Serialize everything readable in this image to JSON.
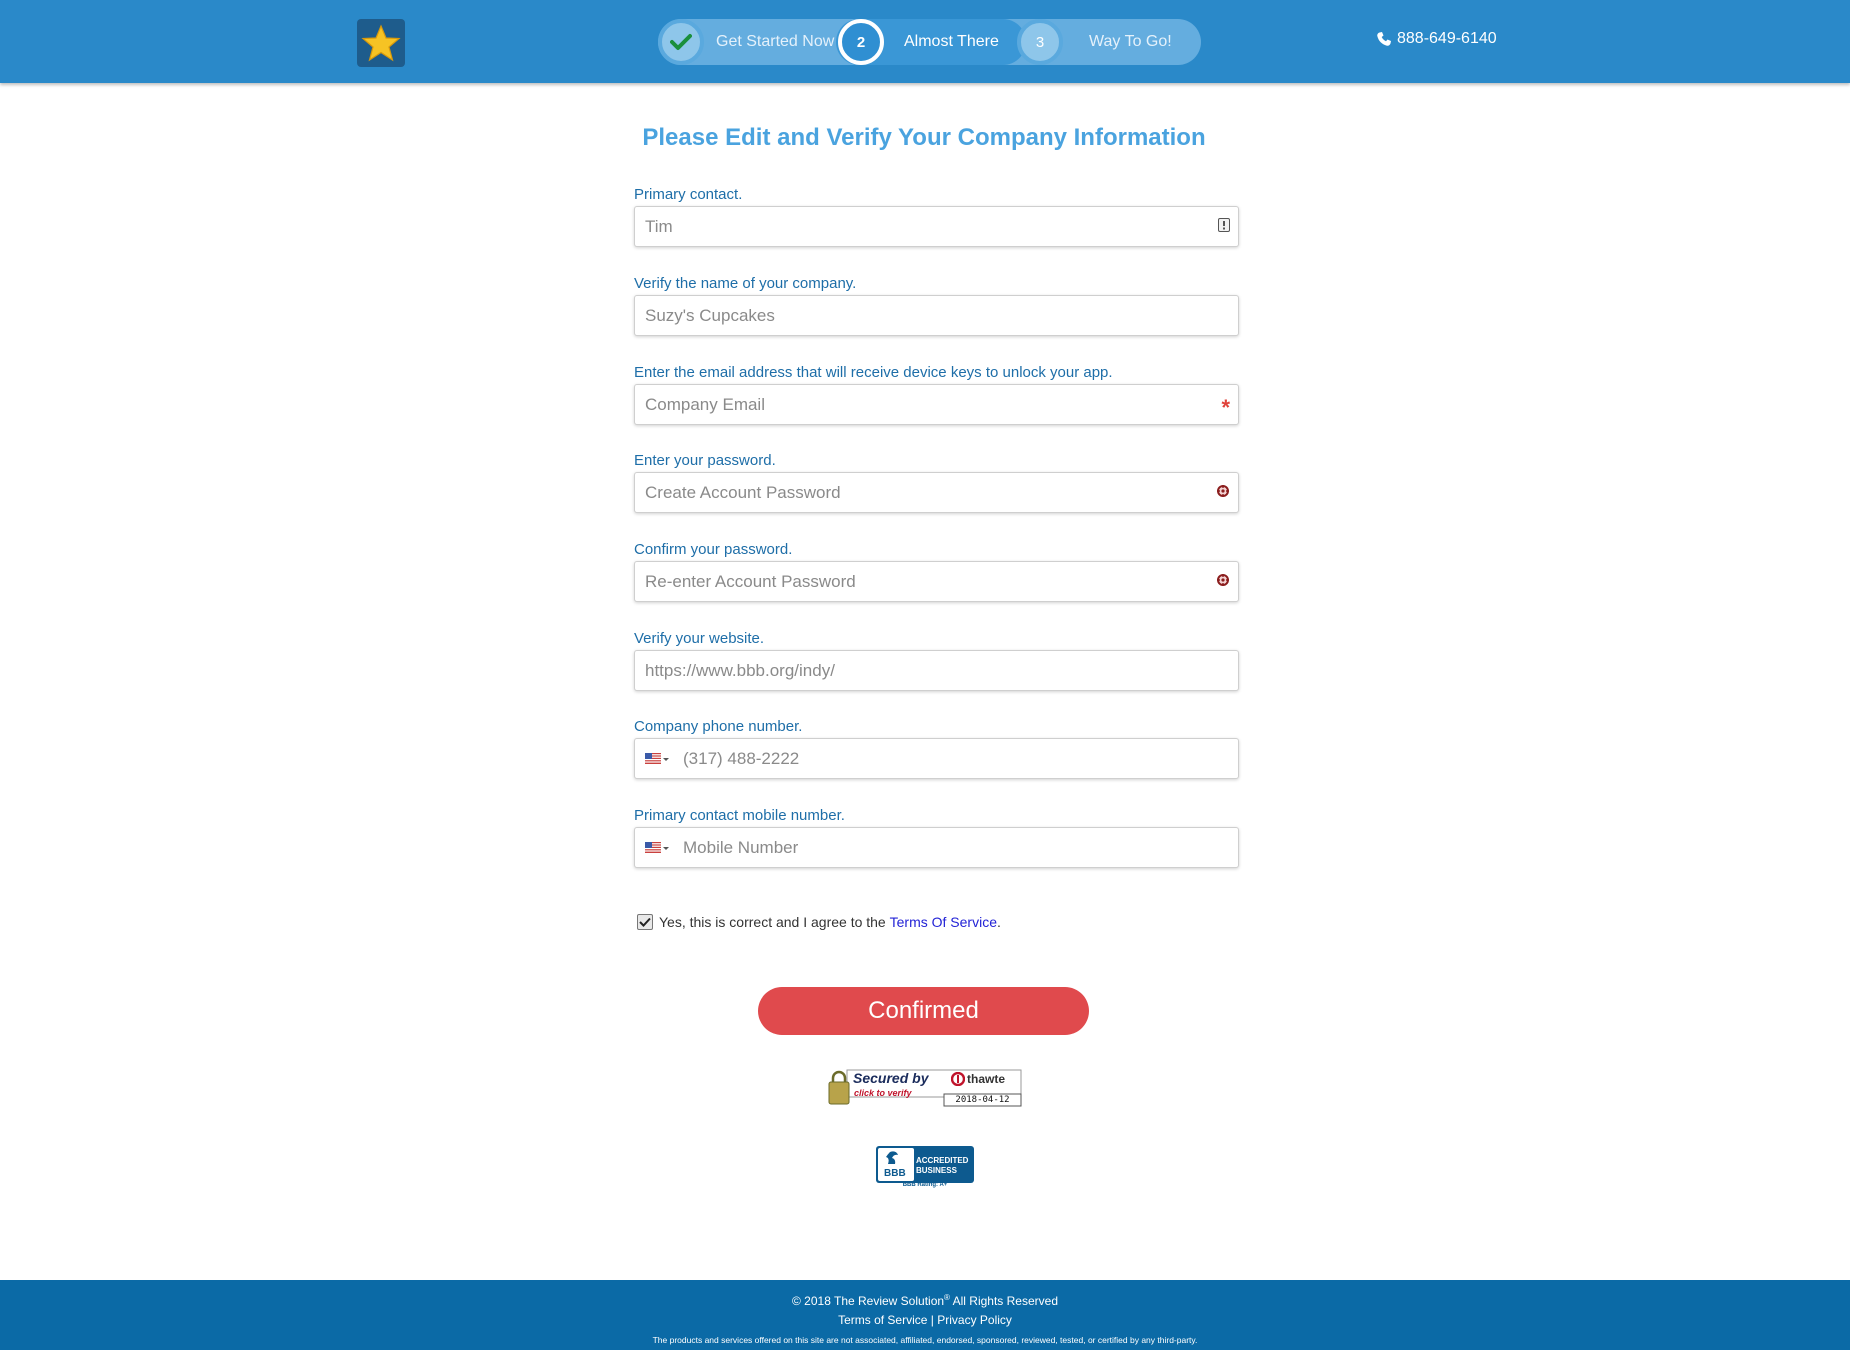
{
  "header": {
    "phone": "888-649-6140",
    "steps": [
      {
        "number": "",
        "label": "Get Started Now",
        "state": "complete"
      },
      {
        "number": "2",
        "label": "Almost There",
        "state": "active"
      },
      {
        "number": "3",
        "label": "Way To Go!",
        "state": "upcoming"
      }
    ]
  },
  "page": {
    "title": "Please Edit and Verify Your Company Information"
  },
  "form": {
    "primary_contact": {
      "label": "Primary contact.",
      "value": "Tim"
    },
    "company_name": {
      "label": "Verify the name of your company.",
      "value": "Suzy's Cupcakes"
    },
    "email": {
      "label": "Enter the email address that will receive device keys to unlock your app.",
      "placeholder": "Company Email",
      "required_mark": "*"
    },
    "password": {
      "label": "Enter your password.",
      "placeholder": "Create Account Password"
    },
    "confirm_password": {
      "label": "Confirm your password.",
      "placeholder": "Re-enter Account Password"
    },
    "website": {
      "label": "Verify your website.",
      "value": "https://www.bbb.org/indy/"
    },
    "company_phone": {
      "label": "Company phone number.",
      "value": "(317) 488-2222"
    },
    "mobile": {
      "label": "Primary contact mobile number.",
      "placeholder": "Mobile Number"
    },
    "agree": {
      "text": "Yes, this is correct and I agree to the ",
      "link": "Terms Of Service",
      "after": ".",
      "checked": true
    },
    "submit_label": "Confirmed"
  },
  "badges": {
    "seal_title": "Secured by",
    "seal_brand": "thawte",
    "seal_sub": "click to verify",
    "seal_date": "2018-04-12",
    "bbb_line1": "ACCREDITED",
    "bbb_line2": "BUSINESS",
    "bbb_logo": "BBB",
    "bbb_rating": "BBB Rating: A+"
  },
  "footer": {
    "copyright": "© 2018 The Review Solution",
    "reg": "®",
    "rights": " All Rights Reserved",
    "terms": "Terms of Service",
    "separator": " | ",
    "privacy": "Privacy Policy",
    "disclaimer": "The products and services offered on this site are not associated, affiliated, endorsed, sponsored, reviewed, tested, or certified by any third-party."
  },
  "colors": {
    "header_bg": "#2a89c9",
    "accent": "#4aa3df",
    "button": "#e04a4d",
    "footer_bg": "#0b6aa6"
  }
}
